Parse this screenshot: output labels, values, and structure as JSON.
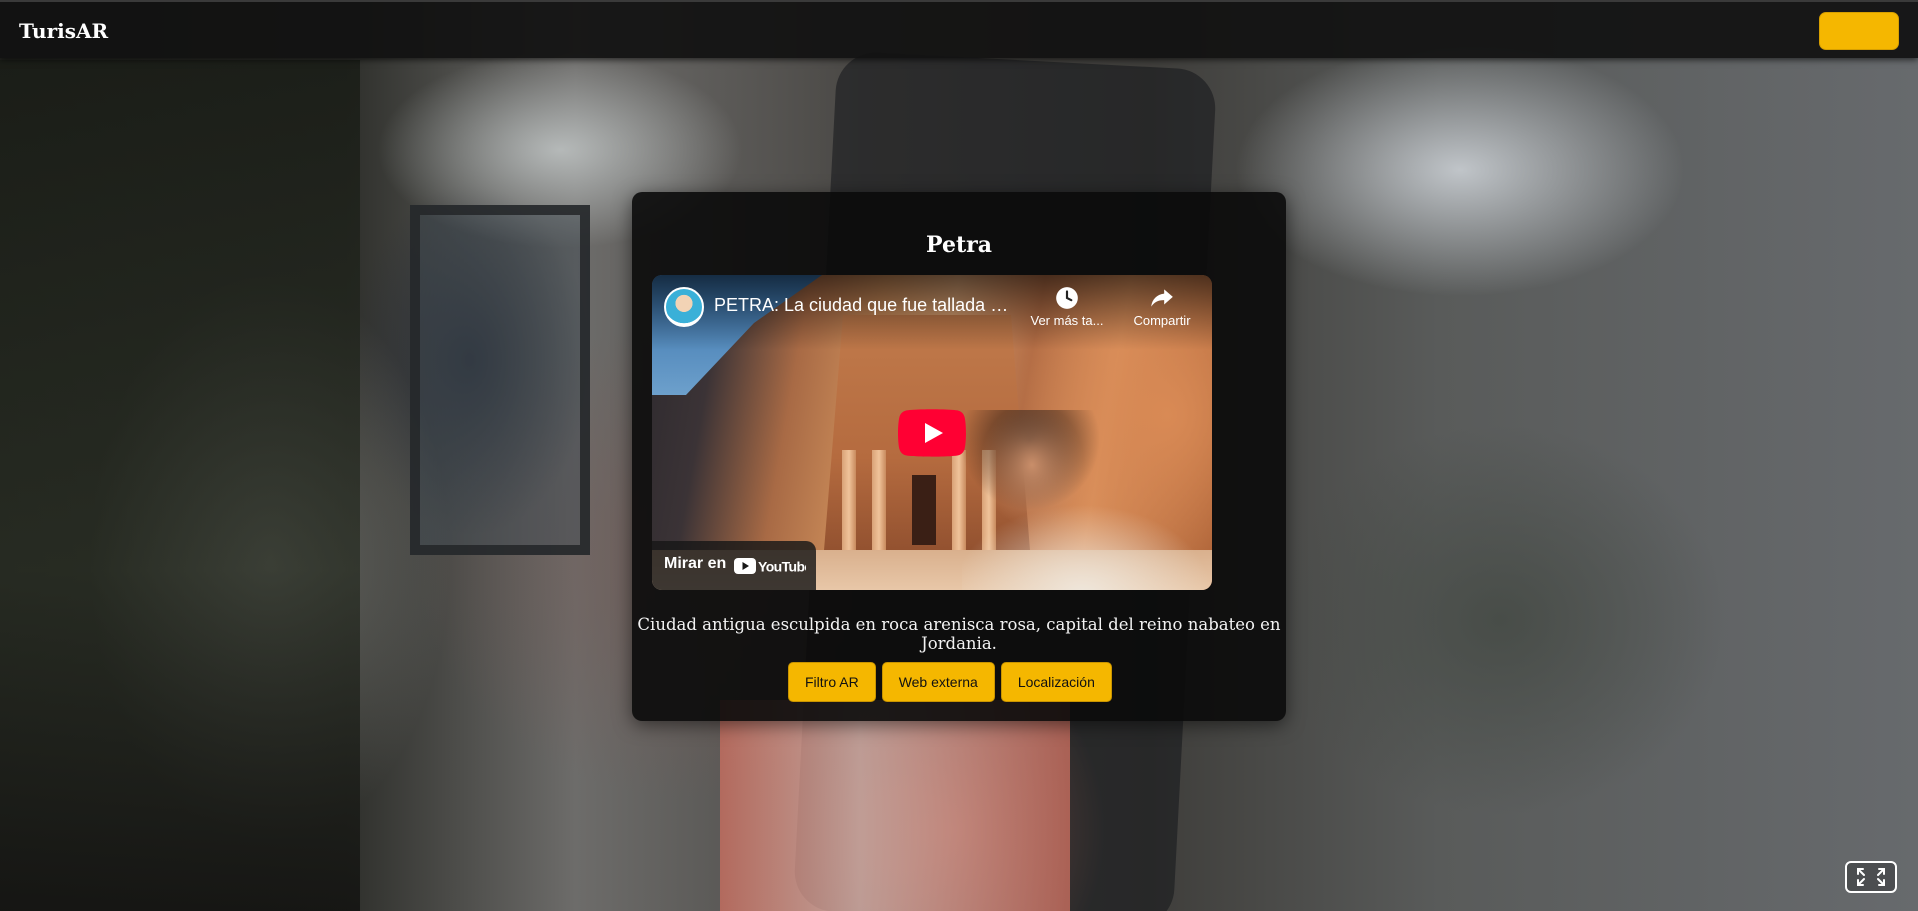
{
  "app": {
    "brand": "TurisAR"
  },
  "card": {
    "title": "Petra",
    "description": "Ciudad antigua esculpida en roca arenisca rosa, capital del reino nabateo en Jordania.",
    "video": {
      "title": "PETRA: La ciudad que fue tallada en...",
      "watch_later_label": "Ver más ta...",
      "share_label": "Compartir",
      "watch_on_label": "Mirar en",
      "platform": "YouTube"
    },
    "actions": [
      {
        "label": "Filtro AR"
      },
      {
        "label": "Web externa"
      },
      {
        "label": "Localización"
      }
    ]
  },
  "colors": {
    "accent": "#f5b700",
    "topbar": "#111111",
    "card_bg": "#0a0a0a",
    "youtube_red": "#ff0033"
  },
  "icons": {
    "watch_later": "clock-icon",
    "share": "share-arrow-icon",
    "play": "youtube-play-icon",
    "fullscreen": "expand-corners-icon"
  }
}
